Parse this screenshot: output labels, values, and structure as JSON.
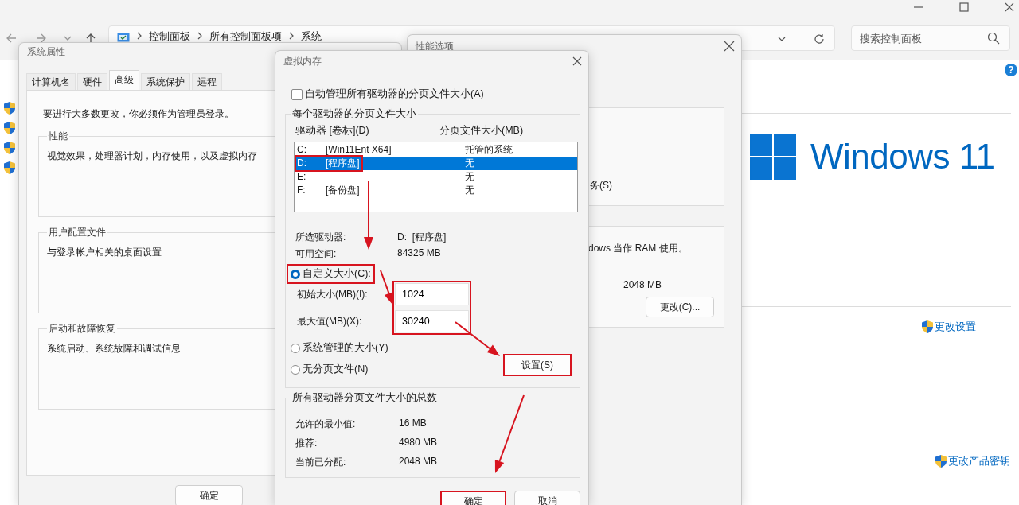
{
  "explorer": {
    "breadcrumb": [
      "控制面板",
      "所有控制面板项",
      "系统"
    ],
    "search": {
      "placeholder": "搜索控制面板"
    },
    "help_icon": "?",
    "product_name": "Windows 11",
    "links": [
      "更改设置",
      "更改产品密钥"
    ]
  },
  "system_properties": {
    "title": "系统属性",
    "tabs": [
      {
        "label": "计算机名",
        "selected": false
      },
      {
        "label": "硬件",
        "selected": false
      },
      {
        "label": "高级",
        "selected": true
      },
      {
        "label": "系统保护",
        "selected": false
      },
      {
        "label": "远程",
        "selected": false
      }
    ],
    "admin_note": "要进行大多数更改，你必须作为管理员登录。",
    "groups": [
      {
        "title": "性能",
        "description": "视觉效果，处理器计划，内存使用，以及虚拟内存"
      },
      {
        "title": "用户配置文件",
        "description": "与登录帐户相关的桌面设置"
      },
      {
        "title": "启动和故障恢复",
        "description": "系统启动、系统故障和调试信息"
      }
    ],
    "buttons": [
      "确定"
    ]
  },
  "performance_options": {
    "title": "性能选项",
    "group_1": {
      "text": "务(S)"
    },
    "group_2": {
      "text": "dows 当作 RAM 使用。",
      "value": "2048 MB",
      "button": "更改(C)..."
    }
  },
  "virtual_memory": {
    "title": "虚拟内存",
    "auto_manage": {
      "label": "自动管理所有驱动器的分页文件大小(A)",
      "checked": false
    },
    "per_drive": {
      "title": "每个驱动器的分页文件大小",
      "columns": [
        "驱动器 [卷标](D)",
        "分页文件大小(MB)"
      ],
      "drives": [
        {
          "drive": "C:",
          "label": "[Win11Ent X64]",
          "size": "托管的系统",
          "selected": false,
          "highlighted": false
        },
        {
          "drive": "D:",
          "label": "[程序盘]",
          "size": "无",
          "selected": true,
          "highlighted": true
        },
        {
          "drive": "E:",
          "size": "无",
          "selected": false,
          "highlighted": false
        },
        {
          "drive": "F:",
          "label": "[备份盘]",
          "size": "无",
          "selected": false,
          "highlighted": false
        }
      ],
      "info": [
        {
          "label": "所选驱动器:",
          "value": "D:  [程序盘]"
        },
        {
          "label": "可用空间:",
          "value": "84325 MB"
        }
      ],
      "options": [
        {
          "label": "自定义大小(C):",
          "selected": true,
          "highlighted": true,
          "fields_highlighted": true,
          "fields": [
            {
              "label": "初始大小(MB)(I):",
              "value": "1024"
            },
            {
              "label": "最大值(MB)(X):",
              "value": "30240"
            }
          ]
        },
        {
          "label": "系统管理的大小(Y)",
          "selected": false,
          "highlighted": false
        },
        {
          "label": "无分页文件(N)",
          "selected": false,
          "highlighted": false
        }
      ],
      "set_button": {
        "label": "设置(S)",
        "highlighted": true
      }
    },
    "totals": {
      "title": "所有驱动器分页文件大小的总数",
      "rows": [
        {
          "label": "允许的最小值:",
          "value": "16 MB"
        },
        {
          "label": "推荐:",
          "value": "4980 MB"
        },
        {
          "label": "当前已分配:",
          "value": "2048 MB"
        }
      ]
    },
    "buttons": [
      {
        "label": "确定",
        "highlighted": true
      },
      {
        "label": "取消",
        "highlighted": false
      }
    ]
  }
}
